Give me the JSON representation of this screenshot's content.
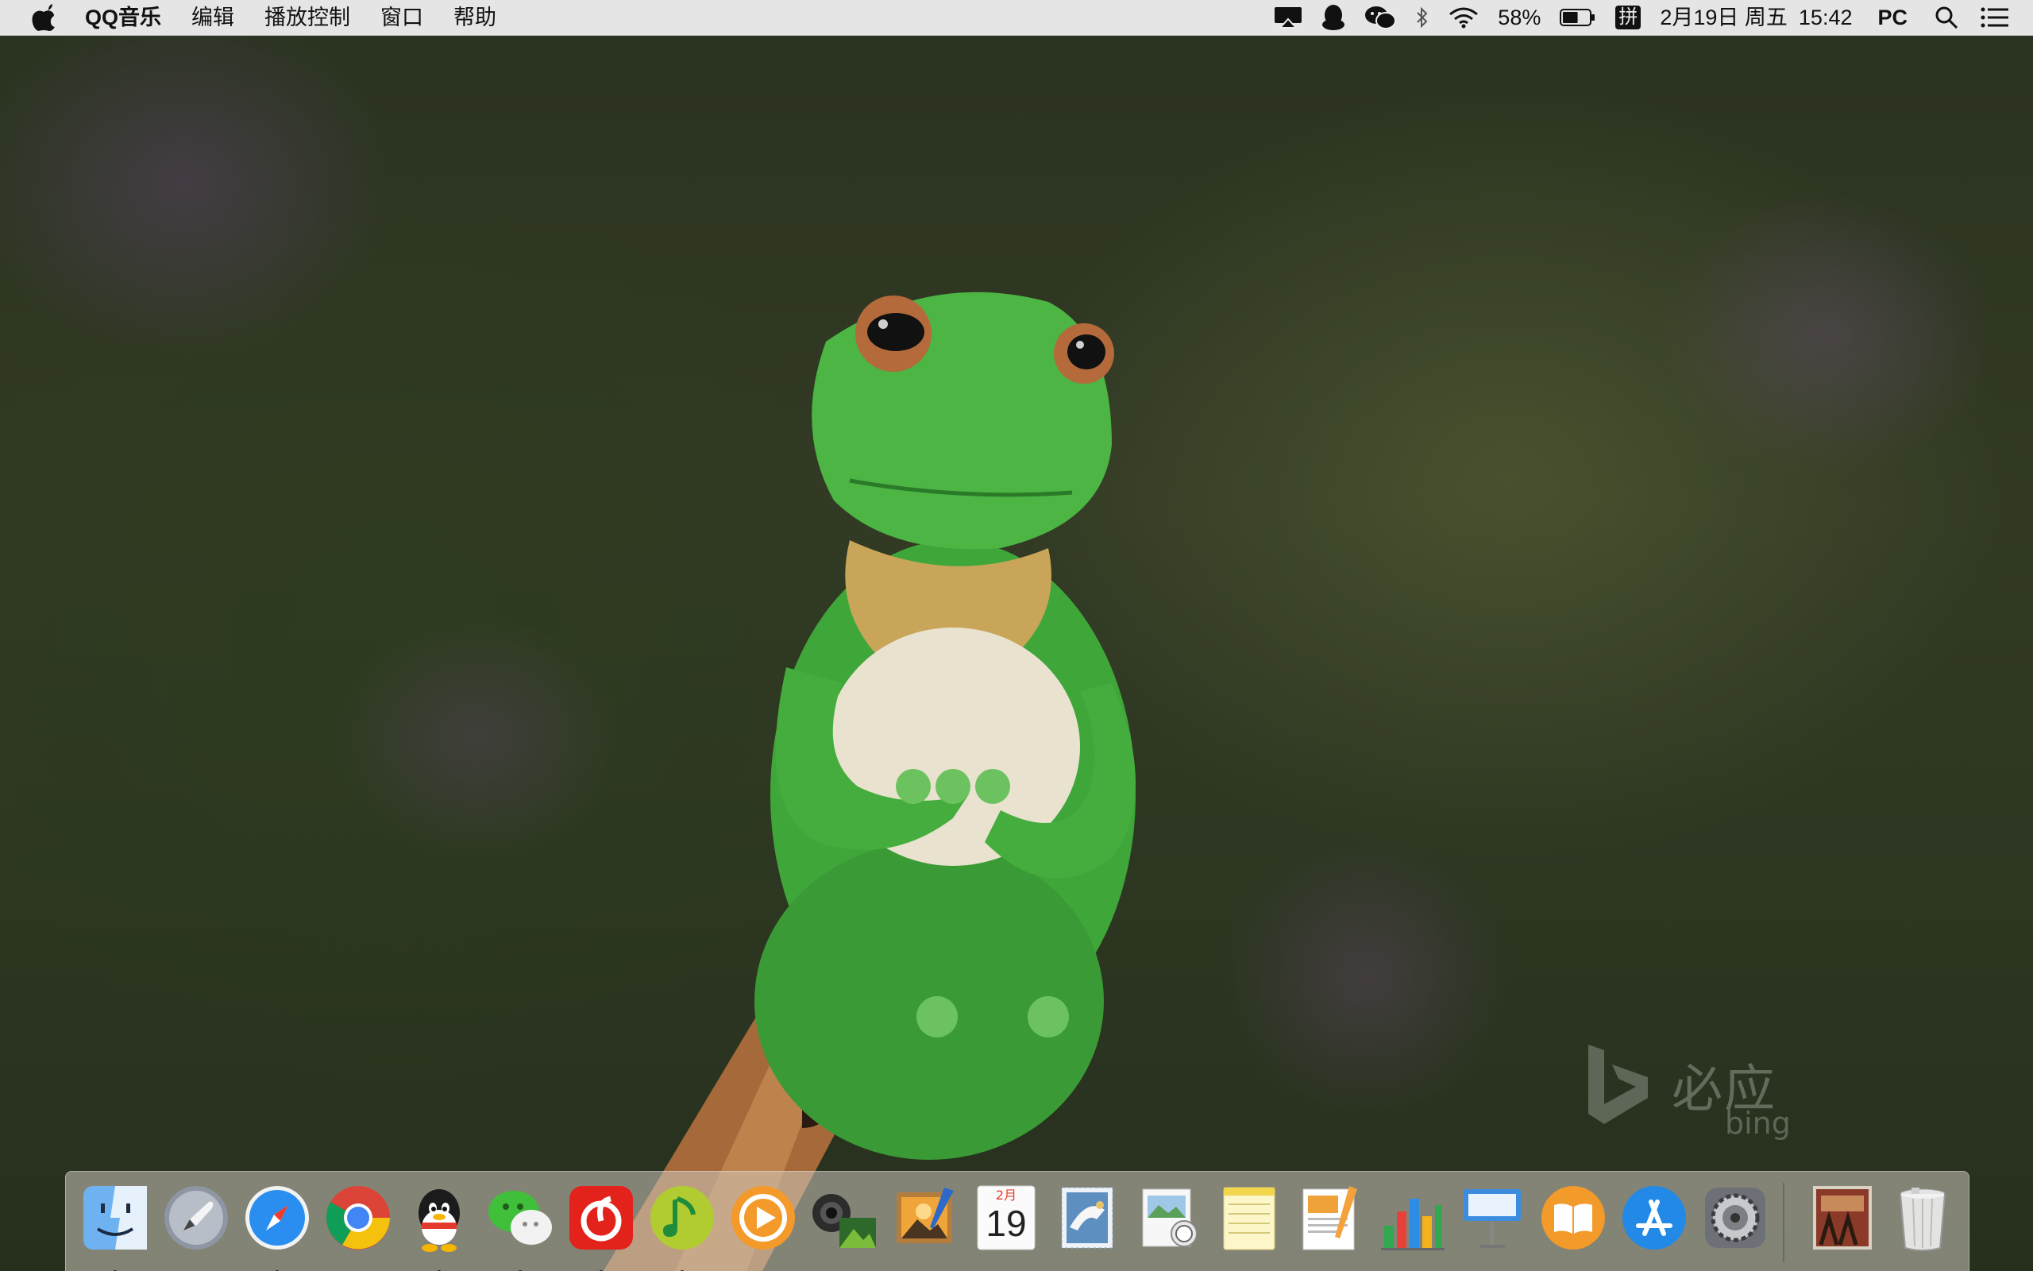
{
  "menubar": {
    "app_name": "QQ音乐",
    "menus": [
      "编辑",
      "播放控制",
      "窗口",
      "帮助"
    ],
    "status": {
      "battery_percent": "58%",
      "battery_level": 0.58,
      "input_method": "拼",
      "date": "2月19日 周五",
      "time": "15:42",
      "user": "PC",
      "icons": [
        "airplay-icon",
        "qq-icon",
        "wechat-icon",
        "bluetooth-icon",
        "wifi-icon",
        "battery-icon",
        "input-method-icon",
        "spotlight-icon",
        "notification-center-icon"
      ]
    }
  },
  "desktop": {
    "watermark_cn": "必应",
    "watermark_en": "bing"
  },
  "dock": {
    "calendar_month": "2月",
    "calendar_day": "19",
    "apps": [
      {
        "name": "finder",
        "running": true
      },
      {
        "name": "launchpad",
        "running": false
      },
      {
        "name": "safari",
        "running": true
      },
      {
        "name": "chrome",
        "running": false
      },
      {
        "name": "qq",
        "running": true
      },
      {
        "name": "wechat",
        "running": true
      },
      {
        "name": "netease-music",
        "running": true
      },
      {
        "name": "qq-music",
        "running": true
      },
      {
        "name": "infuse-player",
        "running": false
      },
      {
        "name": "image-capture",
        "running": false
      },
      {
        "name": "photos-editor",
        "running": false
      },
      {
        "name": "calendar",
        "running": false
      },
      {
        "name": "mail",
        "running": false
      },
      {
        "name": "preview",
        "running": false
      },
      {
        "name": "notes",
        "running": false
      },
      {
        "name": "pages",
        "running": false
      },
      {
        "name": "numbers",
        "running": false
      },
      {
        "name": "keynote",
        "running": false
      },
      {
        "name": "ibooks",
        "running": false
      },
      {
        "name": "app-store",
        "running": false
      },
      {
        "name": "system-preferences",
        "running": false
      },
      {
        "name": "album-stack",
        "running": false
      },
      {
        "name": "trash",
        "running": false
      }
    ]
  }
}
